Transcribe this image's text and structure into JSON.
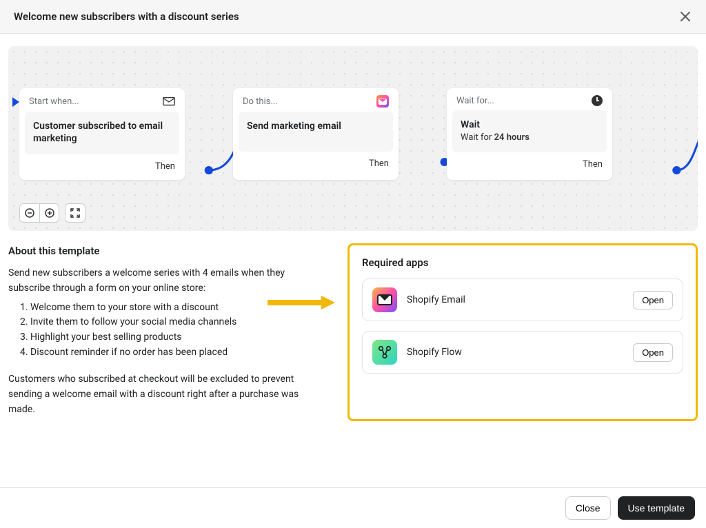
{
  "modal": {
    "title": "Welcome new subscribers with a discount series"
  },
  "flow": {
    "card1": {
      "head": "Start when...",
      "title": "Customer subscribed to email marketing",
      "foot": "Then",
      "icon": "envelope-icon"
    },
    "card2": {
      "head": "Do this...",
      "title": "Send marketing email",
      "foot": "Then",
      "icon": "email-app-icon"
    },
    "card3": {
      "head": "Wait for...",
      "title": "Wait",
      "subtitle_prefix": "Wait for ",
      "subtitle_bold": "24 hours",
      "foot": "Then",
      "icon": "clock-icon"
    }
  },
  "about": {
    "heading": "About this template",
    "intro": "Send new subscribers a welcome series with 4 emails when they subscribe through a form on your online store:",
    "items": [
      "Welcome them to your store with a discount",
      "Invite them to follow your social media channels",
      "Highlight your best selling products",
      "Discount reminder if no order has been placed"
    ],
    "outro": "Customers who subscribed at checkout will be excluded to prevent sending a welcome email with a discount right after a purchase was made."
  },
  "required": {
    "heading": "Required apps",
    "apps": [
      {
        "name": "Shopify Email",
        "button": "Open",
        "icon": "shopify-email-icon"
      },
      {
        "name": "Shopify Flow",
        "button": "Open",
        "icon": "shopify-flow-icon"
      }
    ]
  },
  "footer": {
    "close": "Close",
    "use": "Use template"
  }
}
